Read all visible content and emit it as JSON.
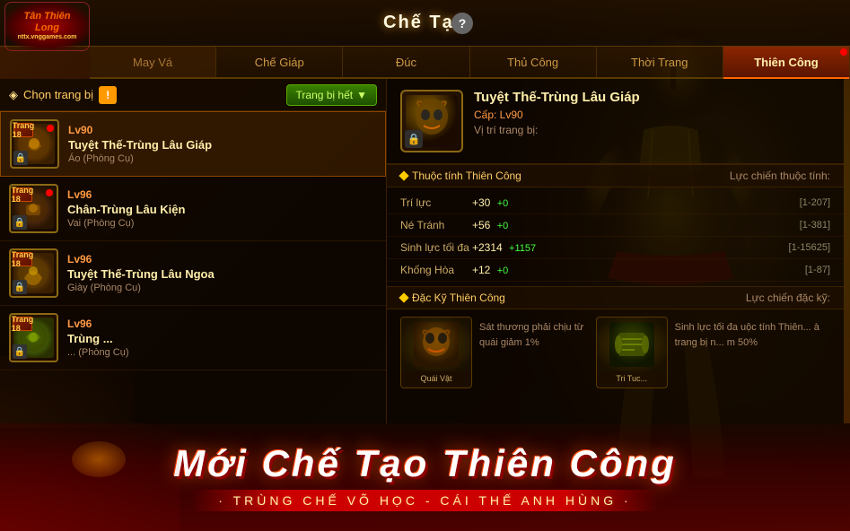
{
  "title": "Chế Tạo",
  "logo": {
    "line1": "Tân Thiên",
    "line2": "Long",
    "subtitle": "nttx.vnggames.com"
  },
  "nav": {
    "tabs": [
      {
        "label": "May Vá",
        "active": false,
        "badge": false
      },
      {
        "label": "Chế Giáp",
        "active": false,
        "badge": false
      },
      {
        "label": "Đúc",
        "active": false,
        "badge": false
      },
      {
        "label": "Thủ Công",
        "active": false,
        "badge": false
      },
      {
        "label": "Thời Trang",
        "active": false,
        "badge": false
      },
      {
        "label": "Thiên Công",
        "active": true,
        "badge": true
      }
    ]
  },
  "left_panel": {
    "header_label": "Chọn trang bị",
    "sort_button": "Trang bị hết",
    "items": [
      {
        "tier": "Trang 18",
        "level": "Lv90",
        "name": "Tuyệt Thế-Trùng Lâu Giáp",
        "type": "Áo (Phòng Cụ)",
        "selected": true,
        "dot": true
      },
      {
        "tier": "Trang 18",
        "level": "Lv96",
        "name": "Chân-Trùng Lâu Kiện",
        "type": "Vai (Phòng Cụ)",
        "selected": false,
        "dot": true
      },
      {
        "tier": "Trang 18",
        "level": "Lv96",
        "name": "Tuyệt Thế-Trùng Lâu Ngoa",
        "type": "Giày (Phòng Cụ)",
        "selected": false,
        "dot": false
      },
      {
        "tier": "Trang 18",
        "level": "Lv96",
        "name": "Trùng ...",
        "type": "... (Phòng Cụ)",
        "selected": false,
        "dot": false
      }
    ]
  },
  "right_panel": {
    "item_name": "Tuyệt Thế-Trùng Lâu Giáp",
    "item_level": "Cấp: Lv90",
    "item_position": "Vị trí trang bị:",
    "attr_section": "Thuộc tính Thiên Công",
    "attr_subtitle": "Lực chiến thuộc tính:",
    "attributes": [
      {
        "name": "Trí lực",
        "base": "+30",
        "bonus": "+0",
        "range": "[1-207]"
      },
      {
        "name": "Né Tránh",
        "base": "+56",
        "bonus": "+0",
        "range": "[1-381]"
      },
      {
        "name": "Sinh lực tối đa",
        "base": "+2314",
        "bonus": "+1157",
        "range": "[1-15625]"
      },
      {
        "name": "Khống Hòa",
        "base": "+12",
        "bonus": "+0",
        "range": "[1-87]"
      }
    ],
    "skill_section": "Đặc Kỹ Thiên Công",
    "skill_subtitle": "Lực chiến đặc kỹ:",
    "skills": [
      {
        "icon_type": "beast",
        "label": "Quái Vật",
        "description": "Sát thương phải chịu từ quái giảm 1%"
      },
      {
        "icon_type": "scroll",
        "label": "Tri Tuc...",
        "description": "Sinh lực tối đa uộc tính Thiên... à trang bị n... m 50%"
      }
    ]
  },
  "bottom_banner": {
    "main_text": "Mới Chế Tạo Thiên Công",
    "sub_text": "· TRÙNG CHẾ VÕ HỌC - CÁI THẾ ANH HÙNG ·"
  },
  "colors": {
    "accent": "#ffcc44",
    "active_tab_bg": "#8B2500",
    "selected_item_border": "#8B4500",
    "positive_attr": "#44ff44",
    "title_color": "#fff8e0"
  }
}
